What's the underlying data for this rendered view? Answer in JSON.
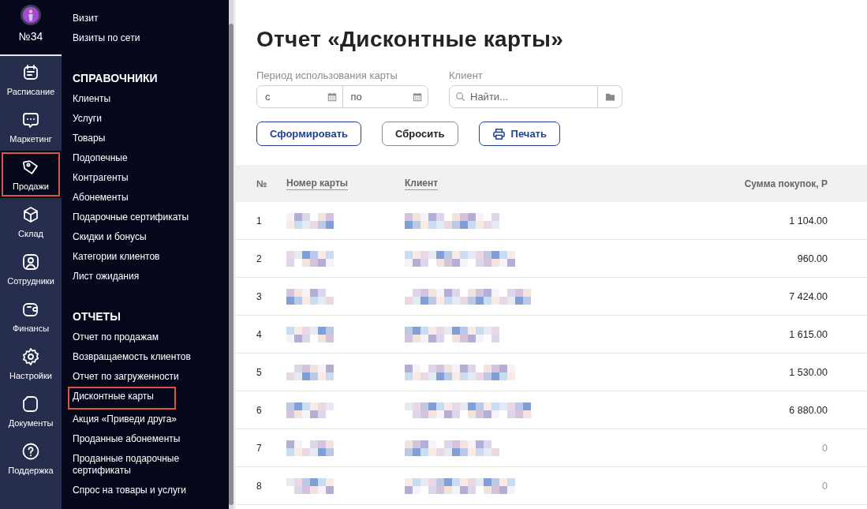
{
  "profile": {
    "label": "№34"
  },
  "rail": [
    {
      "label": "Расписание",
      "selected": false,
      "highlighted": false
    },
    {
      "label": "Маркетинг",
      "selected": false,
      "highlighted": false
    },
    {
      "label": "Продажи",
      "selected": true,
      "highlighted": true
    },
    {
      "label": "Склад",
      "selected": false,
      "highlighted": false
    },
    {
      "label": "Сотрудники",
      "selected": false,
      "highlighted": false
    },
    {
      "label": "Финансы",
      "selected": false,
      "highlighted": false
    },
    {
      "label": "Настройки",
      "selected": false,
      "highlighted": false
    },
    {
      "label": "Документы",
      "selected": false,
      "highlighted": false
    },
    {
      "label": "Поддержка",
      "selected": false,
      "highlighted": false
    }
  ],
  "menu": [
    {
      "items": [
        {
          "label": "Визит",
          "highlighted": false
        },
        {
          "label": "Визиты по сети",
          "highlighted": false
        }
      ]
    },
    {
      "title": "СПРАВОЧНИКИ",
      "items": [
        {
          "label": "Клиенты",
          "highlighted": false
        },
        {
          "label": "Услуги",
          "highlighted": false
        },
        {
          "label": "Товары",
          "highlighted": false
        },
        {
          "label": "Подопечные",
          "highlighted": false
        },
        {
          "label": "Контрагенты",
          "highlighted": false
        },
        {
          "label": "Абонементы",
          "highlighted": false
        },
        {
          "label": "Подарочные сертификаты",
          "highlighted": false
        },
        {
          "label": "Скидки и бонусы",
          "highlighted": false
        },
        {
          "label": "Категории клиентов",
          "highlighted": false
        },
        {
          "label": "Лист ожидания",
          "highlighted": false
        }
      ]
    },
    {
      "title": "ОТЧЕТЫ",
      "items": [
        {
          "label": "Отчет по продажам",
          "highlighted": false
        },
        {
          "label": "Возвращаемость клиентов",
          "highlighted": false
        },
        {
          "label": "Отчет по загруженности",
          "highlighted": false
        },
        {
          "label": "Дисконтные карты",
          "highlighted": true
        },
        {
          "label": "Акция «Приведи друга»",
          "highlighted": false
        },
        {
          "label": "Проданные абонементы",
          "highlighted": false
        },
        {
          "label": "Проданные подарочные сертификаты",
          "highlighted": false
        },
        {
          "label": "Спрос на товары и услуги",
          "highlighted": false
        }
      ]
    }
  ],
  "page": {
    "title": "Отчет «Дисконтные карты»",
    "period": {
      "label": "Период использования карты",
      "from": {
        "placeholder": "с"
      },
      "to": {
        "placeholder": "по"
      }
    },
    "client": {
      "label": "Клиент",
      "placeholder": "Найти..."
    },
    "buttons": [
      {
        "label": "Сформировать",
        "kind": "primary"
      },
      {
        "label": "Сбросить",
        "kind": "plain"
      },
      {
        "label": "Печать",
        "kind": "print"
      }
    ]
  },
  "table": {
    "columns": [
      "№",
      "Номер карты",
      "Клиент",
      "Сумма покупок, Р"
    ],
    "rows": [
      {
        "n": "1",
        "amount": "1 104.00",
        "muted": false
      },
      {
        "n": "2",
        "amount": "960.00",
        "muted": false
      },
      {
        "n": "3",
        "amount": "7 424.00",
        "muted": false
      },
      {
        "n": "4",
        "amount": "1 615.00",
        "muted": false
      },
      {
        "n": "5",
        "amount": "1 530.00",
        "muted": false
      },
      {
        "n": "6",
        "amount": "6 880.00",
        "muted": false
      },
      {
        "n": "7",
        "amount": "0",
        "muted": true
      },
      {
        "n": "8",
        "amount": "0",
        "muted": true
      }
    ]
  }
}
